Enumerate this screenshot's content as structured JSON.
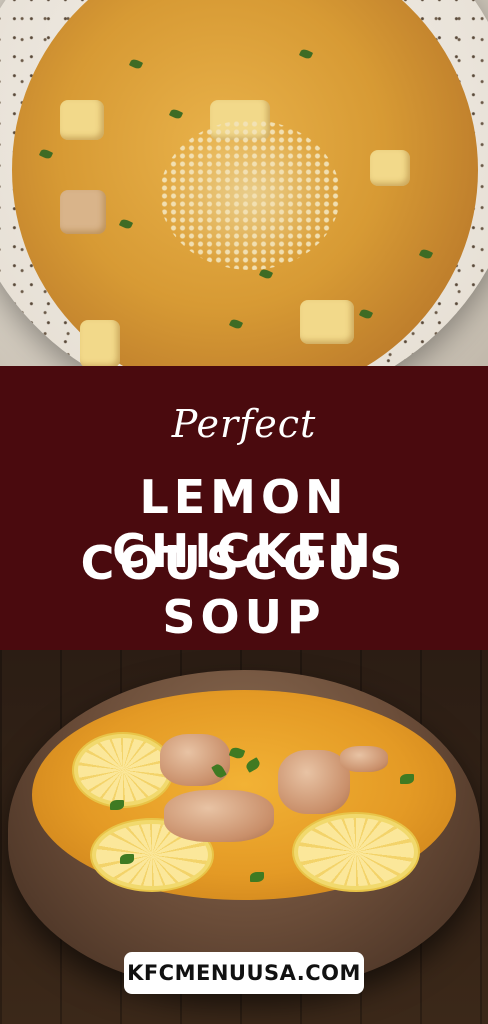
{
  "tagline": "Perfect",
  "title": {
    "line1": "LEMON CHICKEN",
    "line2": "COUSCOUS SOUP"
  },
  "website": "KFCMENUUSA.COM",
  "colors": {
    "band": "#4a0a0e",
    "text": "#ffffff",
    "badge_bg": "#ffffff",
    "badge_text": "#111111"
  }
}
